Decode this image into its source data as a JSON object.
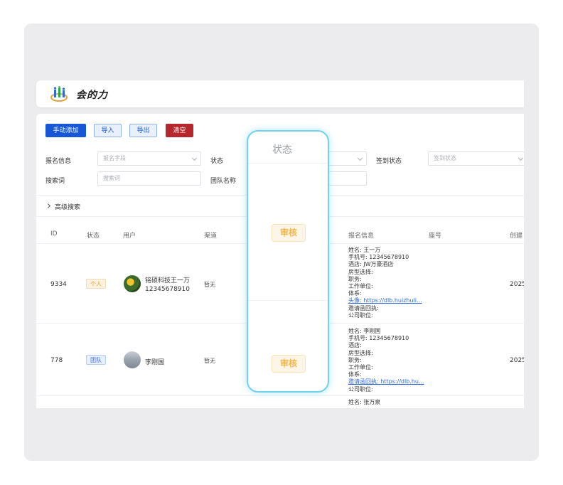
{
  "header": {
    "logo_text": "会的力"
  },
  "toolbar": {
    "add_label": "手动添加",
    "import_label": "导入",
    "export_label": "导出",
    "clear_label": "清空"
  },
  "filters": {
    "signup_info_label": "报名信息",
    "signup_info_placeholder": "报名字段",
    "status_label": "状态",
    "checkin_label": "签到状态",
    "checkin_placeholder": "签到状态",
    "keyword_label": "搜索词",
    "keyword_placeholder": "搜索词",
    "team_label": "团队名称"
  },
  "advanced_search_label": "高级搜索",
  "table": {
    "columns": [
      "ID",
      "状态",
      "用户",
      "渠道",
      "报名信息",
      "座号",
      "创建"
    ],
    "rows": [
      {
        "id": "9334",
        "status": "个人",
        "user_name": "铭硕科技王一万",
        "user_phone": "12345678910",
        "channel": "暂无",
        "info": [
          "姓名: 王一万",
          "手机号: 12345678910",
          "酒店: JW万豪酒店",
          "房型选择:",
          "职务:",
          "工作单位:",
          "体系:",
          "头像: https://dlb.huizhuli...",
          "邀请函回执:",
          "公司职位:"
        ],
        "created": "2025"
      },
      {
        "id": "778",
        "status": "团队",
        "user_name": "李刚国",
        "channel": "暂无",
        "info": [
          "姓名: 李刚国",
          "手机号: 12345678910",
          "酒店:",
          "房型选择:",
          "职务:",
          "工作单位:",
          "体系:",
          "邀请函回执: https://dlb.hu...",
          "公司职位:"
        ],
        "created": "2025"
      },
      {
        "info": [
          "姓名: 张万泉"
        ]
      }
    ]
  },
  "overlay": {
    "title": "状态",
    "action_label": "审核"
  }
}
